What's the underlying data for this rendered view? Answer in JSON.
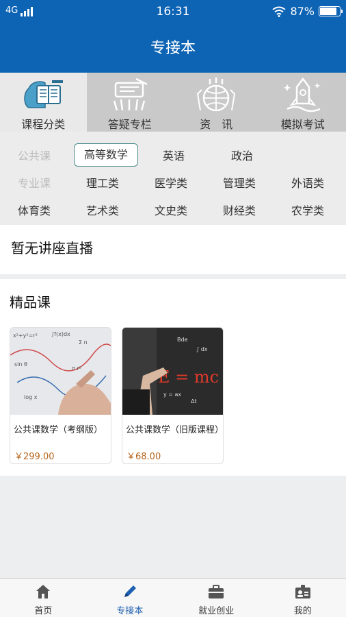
{
  "status": {
    "network": "4G",
    "time": "16:31",
    "battery": "87%",
    "battery_level": 0.87
  },
  "header": {
    "title": "专接本"
  },
  "top_categories": [
    {
      "label": "课程分类",
      "icon": "course-category-icon",
      "active": true
    },
    {
      "label": "答疑专栏",
      "icon": "qa-column-icon",
      "active": false
    },
    {
      "label": "资　讯",
      "icon": "news-icon",
      "active": false
    },
    {
      "label": "模拟考试",
      "icon": "mock-exam-icon",
      "active": false
    }
  ],
  "sub_categories": {
    "public": {
      "label": "公共课",
      "items": [
        "高等数学",
        "英语",
        "政治"
      ],
      "selected": "高等数学"
    },
    "major": {
      "label": "专业课",
      "items": [
        "理工类",
        "医学类",
        "管理类",
        "外语类",
        "体育类",
        "艺术类",
        "文史类",
        "财经类",
        "农学类"
      ]
    }
  },
  "live": {
    "title": "暂无讲座直播"
  },
  "featured": {
    "title": "精品课",
    "courses": [
      {
        "title": "公共课数学（考纲版）",
        "price": "￥299.00"
      },
      {
        "title": "公共课数学（旧版课程）",
        "price": "￥68.00"
      }
    ]
  },
  "tabbar": [
    {
      "label": "首页",
      "icon": "home-icon",
      "active": false
    },
    {
      "label": "专接本",
      "icon": "pen-icon",
      "active": true
    },
    {
      "label": "就业创业",
      "icon": "briefcase-icon",
      "active": false
    },
    {
      "label": "我的",
      "icon": "profile-card-icon",
      "active": false
    }
  ],
  "colors": {
    "brand": "#0d63b4",
    "price": "#b5651d",
    "active_tab": "#1d5fb0"
  }
}
